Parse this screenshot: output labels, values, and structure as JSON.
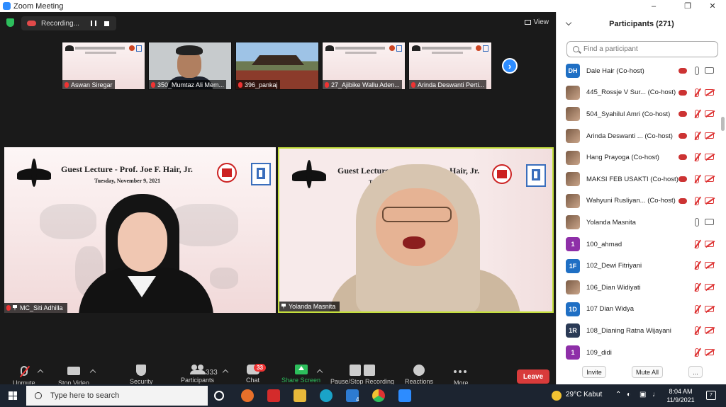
{
  "window": {
    "title": "Zoom Meeting"
  },
  "recording": {
    "label": "Recording..."
  },
  "view": {
    "label": "View"
  },
  "thumbnails": [
    {
      "name": "Aswan Siregar",
      "kind": "slide"
    },
    {
      "name": "350_Mumtaz Ali Mem...",
      "kind": "person"
    },
    {
      "name": "396_pankaj",
      "kind": "temple"
    },
    {
      "name": "27_Ajibike Wallu Aden...",
      "kind": "slide"
    },
    {
      "name": "Arinda Deswanti Perti...",
      "kind": "slide"
    }
  ],
  "slide": {
    "title": "Guest Lecture - Prof. Joe F. Hair, Jr.",
    "date": "Tuesday, November 9, 2021",
    "title_partial": "Guest Lecture",
    "title_tail": "Hair, Jr.",
    "date_partial": "Tues"
  },
  "tiles": {
    "left_name": "MC_Siti Adhilla",
    "right_name": "Yolanda Masnita"
  },
  "toolbar": {
    "unmute": "Unmute",
    "stop_video": "Stop Video",
    "security": "Security",
    "participants": "Participants",
    "participants_count": "333",
    "chat": "Chat",
    "chat_badge": "33",
    "share_screen": "Share Screen",
    "pause_stop": "Pause/Stop Recording",
    "reactions": "Reactions",
    "more": "More",
    "leave": "Leave"
  },
  "panel": {
    "title": "Participants (271)",
    "search_placeholder": "Find a participant",
    "invite": "Invite",
    "mute_all": "Mute All",
    "more": "...",
    "participants": [
      {
        "name": "Dale Hair (Co-host)",
        "avatar": "DH",
        "avatar_color": "#1f6fc4",
        "rec": true,
        "mic": "on",
        "cam": "on"
      },
      {
        "name": "445_Rossje V Sur... (Co-host)",
        "avatar": "",
        "avatar_color": "#7b5b45",
        "rec": true,
        "mic": "off",
        "cam": "off"
      },
      {
        "name": "504_Syahilul Amri (Co-host)",
        "avatar": "",
        "avatar_color": "#3a7fbf",
        "rec": true,
        "mic": "off",
        "cam": "off"
      },
      {
        "name": "Arinda Deswanti ... (Co-host)",
        "avatar": "",
        "avatar_color": "#8a6a55",
        "rec": true,
        "mic": "off",
        "cam": "off"
      },
      {
        "name": "Hang Prayoga (Co-host)",
        "avatar": "",
        "avatar_color": "#3e6b2f",
        "rec": true,
        "mic": "off",
        "cam": "off"
      },
      {
        "name": "MAKSI FEB USAKTI (Co-host)",
        "avatar": "",
        "avatar_color": "#5aaee8",
        "rec": true,
        "mic": "off",
        "cam": "off"
      },
      {
        "name": "Wahyuni Rusliyan... (Co-host)",
        "avatar": "",
        "avatar_color": "#c07a4a",
        "rec": true,
        "mic": "off",
        "cam": "off"
      },
      {
        "name": "Yolanda Masnita",
        "avatar": "",
        "avatar_color": "#6f8fb0",
        "rec": false,
        "mic": "on",
        "cam": "on"
      },
      {
        "name": "100_ahmad",
        "avatar": "1",
        "avatar_color": "#8e2fa8",
        "rec": false,
        "mic": "off",
        "cam": "off"
      },
      {
        "name": "102_Dewi Fitriyani",
        "avatar": "1F",
        "avatar_color": "#1f6fc4",
        "rec": false,
        "mic": "off",
        "cam": "off"
      },
      {
        "name": "106_Dian Widiyati",
        "avatar": "",
        "avatar_color": "#9a6a4a",
        "rec": false,
        "mic": "off",
        "cam": "off"
      },
      {
        "name": "107 Dian Widya",
        "avatar": "1D",
        "avatar_color": "#1f6fc4",
        "rec": false,
        "mic": "off",
        "cam": "off"
      },
      {
        "name": "108_Dianing Ratna Wijayani",
        "avatar": "1R",
        "avatar_color": "#2a3a55",
        "rec": false,
        "mic": "off",
        "cam": "off"
      },
      {
        "name": "109_didi",
        "avatar": "1",
        "avatar_color": "#8e2fa8",
        "rec": false,
        "mic": "off",
        "cam": "off"
      }
    ]
  },
  "taskbar": {
    "search_placeholder": "Type here to search",
    "weather": "29°C  Kabut",
    "time": "8:04 AM",
    "date": "11/9/2021",
    "notifications": "7",
    "mail_badge": "4"
  }
}
